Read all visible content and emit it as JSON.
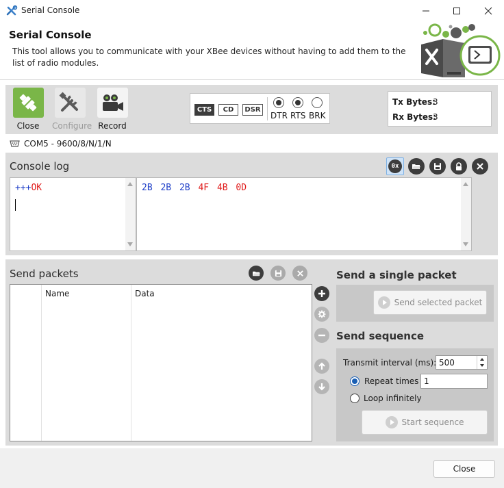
{
  "window": {
    "title": "Serial Console",
    "icon": "xbee-tools-icon"
  },
  "header": {
    "title": "Serial Console",
    "description": "This tool allows you to communicate with your XBee devices without having to add them to the list of radio modules."
  },
  "toolbar": {
    "close_label": "Close",
    "configure_label": "Configure",
    "record_label": "Record",
    "signals": [
      {
        "name": "CTS",
        "active": true
      },
      {
        "name": "CD",
        "active": false
      },
      {
        "name": "DSR",
        "active": false
      }
    ],
    "controls": [
      {
        "name": "DTR",
        "on": true
      },
      {
        "name": "RTS",
        "on": true
      },
      {
        "name": "BRK",
        "on": false
      }
    ],
    "tx_label": "Tx Bytes:",
    "tx_value": "3",
    "rx_label": "Rx Bytes:",
    "rx_value": "3"
  },
  "port": {
    "label": "COM5 - 9600/8/N/1/N"
  },
  "console": {
    "title": "Console log",
    "hex_toggle_label": "0x",
    "ascii_sent": "+++",
    "ascii_received": "OK",
    "hex_sent": [
      "2B",
      "2B",
      "2B"
    ],
    "hex_received": [
      "4F",
      "4B",
      "0D"
    ],
    "sent_color": "#1f3fc8",
    "received_color": "#e01b1b"
  },
  "send_packets": {
    "title": "Send packets",
    "columns": [
      "",
      "Name",
      "Data"
    ],
    "rows": []
  },
  "single_packet": {
    "title": "Send a single packet",
    "button_label": "Send selected packet"
  },
  "sequence": {
    "title": "Send sequence",
    "interval_label": "Transmit interval (ms):",
    "interval_value": "500",
    "repeat_label": "Repeat times",
    "repeat_value": "1",
    "repeat_selected": true,
    "loop_label": "Loop infinitely",
    "start_label": "Start sequence"
  },
  "footer": {
    "close_label": "Close"
  },
  "colors": {
    "accent_green": "#7ab648",
    "panel_gray": "#dcdcdc"
  }
}
